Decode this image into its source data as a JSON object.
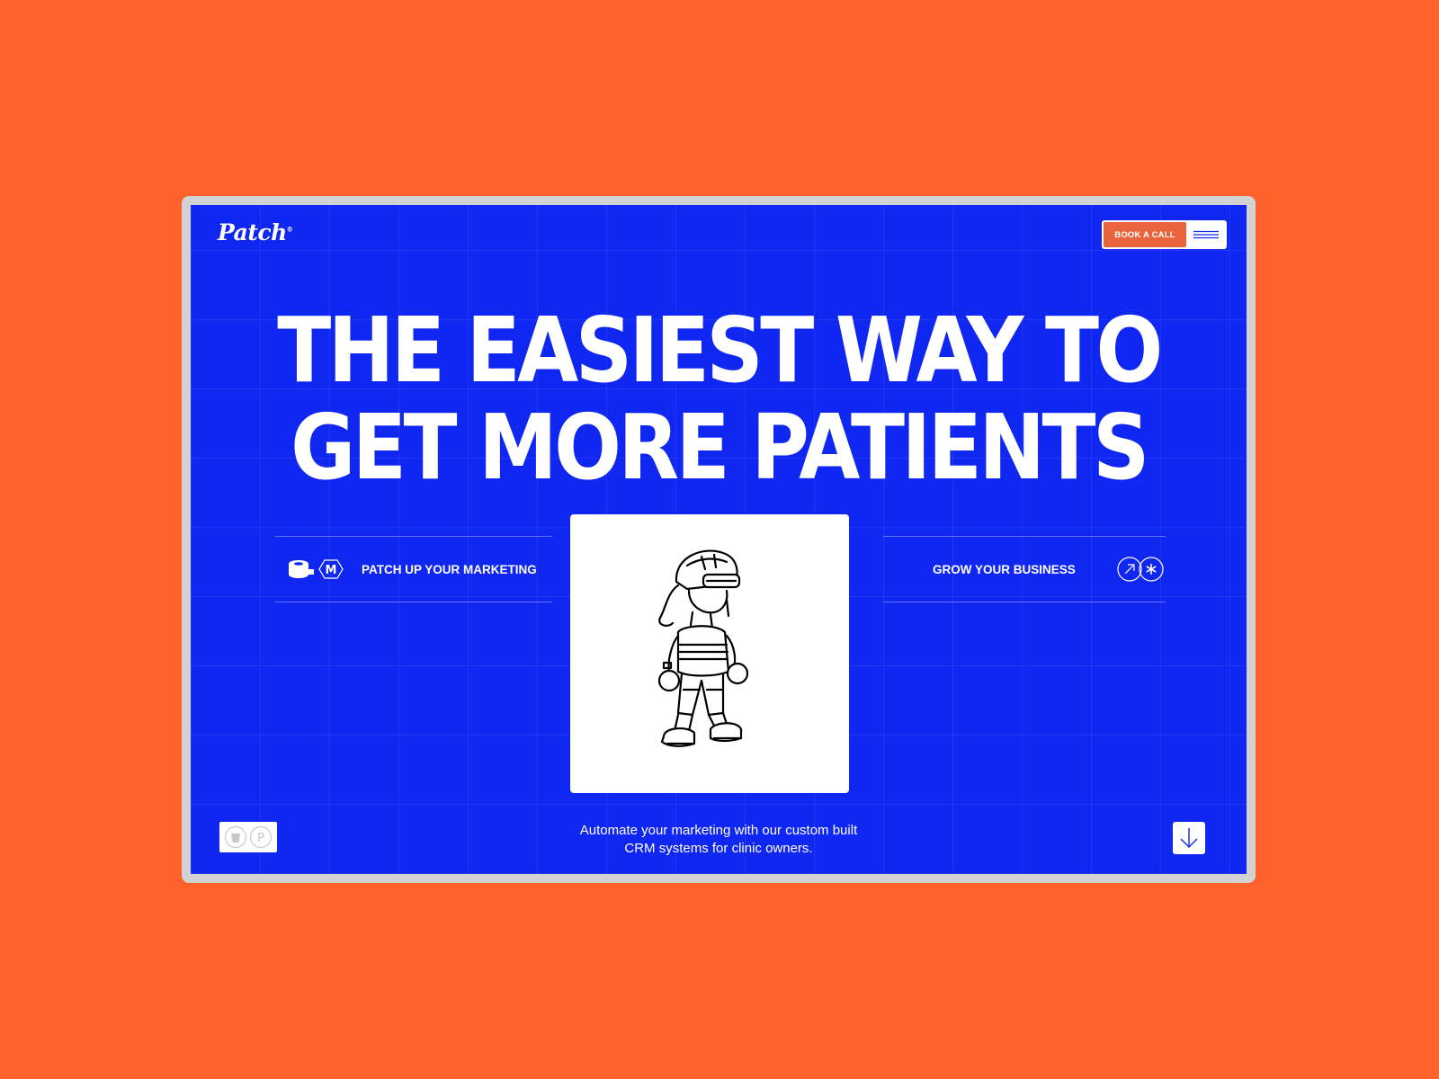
{
  "brand": {
    "logo_text": "Patch"
  },
  "header": {
    "book_call_label": "BOOK A CALL",
    "menu_icon": "hamburger-menu-icon"
  },
  "hero": {
    "headline_line1": "THE EASIEST WAY TO",
    "headline_line2": "GET MORE PATIENTS"
  },
  "features": {
    "left": {
      "label": "PATCH UP YOUR MARKETING",
      "icons": [
        "tape-roll-icon",
        "m-hexagon-icon"
      ],
      "icon_letter": "M"
    },
    "right": {
      "label": "GROW YOUR BUSINESS",
      "icons": [
        "arrow-up-right-icon",
        "asterisk-icon"
      ]
    }
  },
  "illustration": {
    "subject": "walking-character-with-helmet"
  },
  "footer": {
    "tagline_line1": "Automate your marketing with our custom built",
    "tagline_line2": "CRM systems for clinic owners.",
    "badge_icons": [
      "bucket-icon",
      "p-circle-icon"
    ],
    "badge_letter": "P",
    "scroll_icon": "arrow-down-icon"
  },
  "colors": {
    "page_background": "#FF612C",
    "screen_background": "#1027F2",
    "accent": "#E9633C",
    "frame": "#D2D2D2",
    "text": "#FFFFFF"
  }
}
